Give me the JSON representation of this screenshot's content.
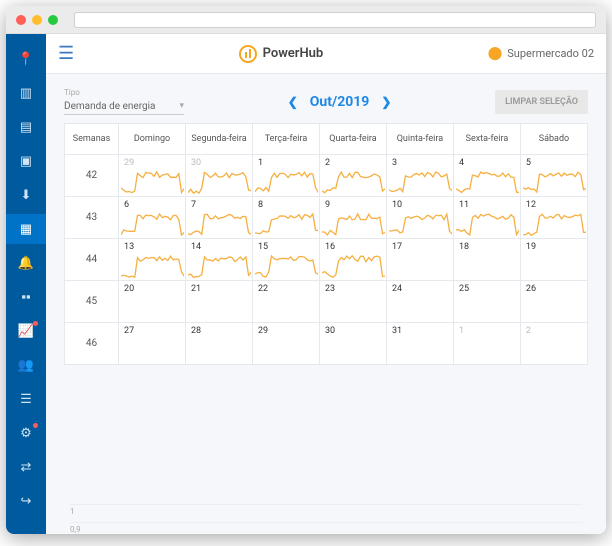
{
  "brand": {
    "name": "PowerHub"
  },
  "location": {
    "name": "Supermercado 02"
  },
  "controls": {
    "type_label": "Tipo",
    "type_value": "Demanda de energia",
    "month": "Out/2019",
    "clear_label": "LIMPAR SELEÇÃO"
  },
  "calendar": {
    "headers": [
      "Semanas",
      "Domingo",
      "Segunda-feira",
      "Terça-feira",
      "Quarta-feira",
      "Quinta-feira",
      "Sexta-feira",
      "Sábado"
    ],
    "weeks": [
      {
        "num": "42",
        "days": [
          {
            "d": "29",
            "muted": true,
            "spark": true
          },
          {
            "d": "30",
            "muted": true,
            "spark": true
          },
          {
            "d": "1",
            "spark": true
          },
          {
            "d": "2",
            "spark": true
          },
          {
            "d": "3",
            "spark": true
          },
          {
            "d": "4",
            "spark": true
          },
          {
            "d": "5",
            "spark": true
          }
        ]
      },
      {
        "num": "43",
        "days": [
          {
            "d": "6",
            "spark": true
          },
          {
            "d": "7",
            "spark": true
          },
          {
            "d": "8",
            "spark": true
          },
          {
            "d": "9",
            "spark": true
          },
          {
            "d": "10",
            "spark": true
          },
          {
            "d": "11",
            "spark": true
          },
          {
            "d": "12",
            "spark": true
          }
        ]
      },
      {
        "num": "44",
        "days": [
          {
            "d": "13",
            "spark": true
          },
          {
            "d": "14",
            "spark": true
          },
          {
            "d": "15",
            "spark": true
          },
          {
            "d": "16",
            "spark": true
          },
          {
            "d": "17",
            "spark": false
          },
          {
            "d": "18",
            "spark": false
          },
          {
            "d": "19",
            "spark": false
          }
        ]
      },
      {
        "num": "45",
        "days": [
          {
            "d": "20",
            "spark": false
          },
          {
            "d": "21",
            "spark": false
          },
          {
            "d": "22",
            "spark": false
          },
          {
            "d": "23",
            "spark": false
          },
          {
            "d": "24",
            "spark": false
          },
          {
            "d": "25",
            "spark": false
          },
          {
            "d": "26",
            "spark": false
          }
        ]
      },
      {
        "num": "46",
        "days": [
          {
            "d": "27",
            "spark": false
          },
          {
            "d": "28",
            "spark": false
          },
          {
            "d": "29",
            "spark": false
          },
          {
            "d": "30",
            "spark": false
          },
          {
            "d": "31",
            "spark": false
          },
          {
            "d": "1",
            "muted": true,
            "spark": false
          },
          {
            "d": "2",
            "muted": true,
            "spark": false
          }
        ]
      }
    ]
  },
  "chart_footer": {
    "tick1": "1",
    "tick2": "0,9"
  },
  "sidebar_icons": [
    {
      "name": "pin-icon",
      "glyph": "📍"
    },
    {
      "name": "bar-chart-icon",
      "glyph": "▥"
    },
    {
      "name": "document-icon",
      "glyph": "▤"
    },
    {
      "name": "clipboard-icon",
      "glyph": "▣"
    },
    {
      "name": "download-icon",
      "glyph": "⬇"
    },
    {
      "name": "calendar-icon",
      "glyph": "▦",
      "active": true
    },
    {
      "name": "bell-icon",
      "glyph": "🔔"
    },
    {
      "name": "grid-icon",
      "glyph": "▪▪"
    },
    {
      "name": "line-chart-icon",
      "glyph": "📈",
      "dot": true
    },
    {
      "name": "users-icon",
      "glyph": "👥"
    },
    {
      "name": "sliders-icon",
      "glyph": "☰"
    },
    {
      "name": "gears-icon",
      "glyph": "⚙",
      "dot": true
    },
    {
      "name": "swap-icon",
      "glyph": "⇄"
    },
    {
      "name": "logout-icon",
      "glyph": "↪"
    }
  ]
}
